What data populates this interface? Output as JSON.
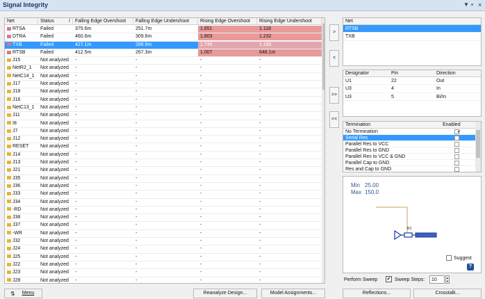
{
  "window": {
    "title": "Signal Integrity",
    "dropdown_glyph": "▼",
    "pin_glyph": "▪",
    "close_glyph": "×"
  },
  "net_grid": {
    "columns": [
      "Net",
      "Status",
      "Falling Edge Overshoot",
      "Falling Edge Undershoot",
      "Rising Edge Overshoot",
      "Rising Edge Undershoot"
    ],
    "sort_glyph": "/",
    "rows": [
      {
        "net": "RTSA",
        "status": "Failed",
        "feo": "375.6m",
        "feu": "251.7m",
        "reo": "1.651",
        "reu": "1.118",
        "color": "#d07a8a"
      },
      {
        "net": "DTRA",
        "status": "Failed",
        "feo": "460.6m",
        "feu": "309.6m",
        "reo": "1.803",
        "reu": "1.232",
        "color": "#d07a8a"
      },
      {
        "net": "TXB",
        "status": "Failed",
        "feo": "427.1m",
        "feu": "286.9m",
        "reo": "1.745",
        "reu": "1.190",
        "color": "#d07a8a"
      },
      {
        "net": "RTSB",
        "status": "Failed",
        "feo": "412.5m",
        "feu": "267.3m",
        "reo": "1.007",
        "reu": "648.1m",
        "color": "#d07a8a"
      },
      {
        "net": "J15",
        "status": "Not analyzed",
        "feo": "-",
        "feu": "-",
        "reo": "-",
        "reu": "-",
        "color": "#e0b830"
      },
      {
        "net": "NetR2_1",
        "status": "Not analyzed",
        "feo": "-",
        "feu": "-",
        "reo": "-",
        "reu": "-",
        "color": "#e0b830"
      },
      {
        "net": "NetC14_1",
        "status": "Not analyzed",
        "feo": "-",
        "feu": "-",
        "reo": "-",
        "reu": "-",
        "color": "#e0b830"
      },
      {
        "net": "J17",
        "status": "Not analyzed",
        "feo": "-",
        "feu": "-",
        "reo": "-",
        "reu": "-",
        "color": "#e0b830"
      },
      {
        "net": "J18",
        "status": "Not analyzed",
        "feo": "-",
        "feu": "-",
        "reo": "-",
        "reu": "-",
        "color": "#e0b830"
      },
      {
        "net": "J16",
        "status": "Not analyzed",
        "feo": "-",
        "feu": "-",
        "reo": "-",
        "reu": "-",
        "color": "#e0b830"
      },
      {
        "net": "NetC13_1",
        "status": "Not analyzed",
        "feo": "-",
        "feu": "-",
        "reo": "-",
        "reu": "-",
        "color": "#e0b830"
      },
      {
        "net": "J11",
        "status": "Not analyzed",
        "feo": "-",
        "feu": "-",
        "reo": "-",
        "reu": "-",
        "color": "#e0b830"
      },
      {
        "net": "I8",
        "status": "Not analyzed",
        "feo": "-",
        "feu": "-",
        "reo": "-",
        "reu": "-",
        "color": "#e0b830"
      },
      {
        "net": "J7",
        "status": "Not analyzed",
        "feo": "-",
        "feu": "-",
        "reo": "-",
        "reu": "-",
        "color": "#e0b830"
      },
      {
        "net": "J12",
        "status": "Not analyzed",
        "feo": "-",
        "feu": "-",
        "reo": "-",
        "reu": "-",
        "color": "#e0b830"
      },
      {
        "net": "RESET",
        "status": "Not analyzed",
        "feo": "-",
        "feu": "-",
        "reo": "-",
        "reu": "-",
        "color": "#e0b830"
      },
      {
        "net": "J14",
        "status": "Not analyzed",
        "feo": "-",
        "feu": "-",
        "reo": "-",
        "reu": "-",
        "color": "#e0b830"
      },
      {
        "net": "J13",
        "status": "Not analyzed",
        "feo": "-",
        "feu": "-",
        "reo": "-",
        "reu": "-",
        "color": "#e0b830"
      },
      {
        "net": "J21",
        "status": "Not analyzed",
        "feo": "-",
        "feu": "-",
        "reo": "-",
        "reu": "-",
        "color": "#e0b830"
      },
      {
        "net": "J35",
        "status": "Not analyzed",
        "feo": "-",
        "feu": "-",
        "reo": "-",
        "reu": "-",
        "color": "#e0b830"
      },
      {
        "net": "J36",
        "status": "Not analyzed",
        "feo": "-",
        "feu": "-",
        "reo": "-",
        "reu": "-",
        "color": "#e0b830"
      },
      {
        "net": "J33",
        "status": "Not analyzed",
        "feo": "-",
        "feu": "-",
        "reo": "-",
        "reu": "-",
        "color": "#e0b830"
      },
      {
        "net": "J34",
        "status": "Not analyzed",
        "feo": "-",
        "feu": "-",
        "reo": "-",
        "reu": "-",
        "color": "#e0b830"
      },
      {
        "net": "-RD",
        "status": "Not analyzed",
        "feo": "-",
        "feu": "-",
        "reo": "-",
        "reu": "-",
        "color": "#e0b830"
      },
      {
        "net": "J38",
        "status": "Not analyzed",
        "feo": "-",
        "feu": "-",
        "reo": "-",
        "reu": "-",
        "color": "#e0b830"
      },
      {
        "net": "J37",
        "status": "Not analyzed",
        "feo": "-",
        "feu": "-",
        "reo": "-",
        "reu": "-",
        "color": "#e0b830"
      },
      {
        "net": "-WR",
        "status": "Not analyzed",
        "feo": "-",
        "feu": "-",
        "reo": "-",
        "reu": "-",
        "color": "#e0b830"
      },
      {
        "net": "J32",
        "status": "Not analyzed",
        "feo": "-",
        "feu": "-",
        "reo": "-",
        "reu": "-",
        "color": "#e0b830"
      },
      {
        "net": "J24",
        "status": "Not analyzed",
        "feo": "-",
        "feu": "-",
        "reo": "-",
        "reu": "-",
        "color": "#e0b830"
      },
      {
        "net": "J25",
        "status": "Not analyzed",
        "feo": "-",
        "feu": "-",
        "reo": "-",
        "reu": "-",
        "color": "#e0b830"
      },
      {
        "net": "J22",
        "status": "Not analyzed",
        "feo": "-",
        "feu": "-",
        "reo": "-",
        "reu": "-",
        "color": "#e0b830"
      },
      {
        "net": "J23",
        "status": "Not analyzed",
        "feo": "-",
        "feu": "-",
        "reo": "-",
        "reu": "-",
        "color": "#e0b830"
      },
      {
        "net": "J28",
        "status": "Not analyzed",
        "feo": "-",
        "feu": "-",
        "reo": "-",
        "reu": "-",
        "color": "#e0b830"
      }
    ]
  },
  "middle_buttons": [
    ">",
    "<",
    ">>",
    "<<"
  ],
  "selected_nets": {
    "header": "Net",
    "items": [
      "RTSB",
      "TXB"
    ]
  },
  "designators": {
    "columns": [
      "Designator",
      "Pin",
      "Direction"
    ],
    "rows": [
      [
        "U1",
        "22",
        "Out"
      ],
      [
        "U3",
        "4",
        "In"
      ],
      [
        "U3",
        "5",
        "Bi/In"
      ]
    ]
  },
  "terminations": {
    "columns": [
      "Termination",
      "Enabled"
    ],
    "rows": [
      {
        "label": "No Termination",
        "enabled": "✔"
      },
      {
        "label": "Serial Res",
        "enabled": ""
      },
      {
        "label": "Parallel Res to VCC",
        "enabled": ""
      },
      {
        "label": "Parallel Res to GND",
        "enabled": ""
      },
      {
        "label": "Parallel Res to VCC & GND",
        "enabled": ""
      },
      {
        "label": "Parallel Cap to GND",
        "enabled": ""
      },
      {
        "label": "Res and Cap to GND",
        "enabled": ""
      }
    ]
  },
  "preview": {
    "min_label": "Min",
    "min_value": "25.00",
    "max_label": "Max",
    "max_value": "150.0",
    "resistor_label": "R1",
    "suggest_label": "Suggest",
    "help_glyph": "?"
  },
  "sweep": {
    "perform_label": "Perform Sweep",
    "steps_label": "Sweep Steps:",
    "steps_value": "10",
    "checked": "✔"
  },
  "buttons": {
    "menu": "Menu",
    "reanalyze": "Reanalyze Design...",
    "model": "Model Assignments...",
    "reflections": "Reflections...",
    "crosstalk": "Crosstalk..."
  },
  "colors": {
    "failed": "#d07a8a",
    "not_analyzed": "#e0b830",
    "selection": "#3399ff",
    "danger": "#e99a9a"
  }
}
